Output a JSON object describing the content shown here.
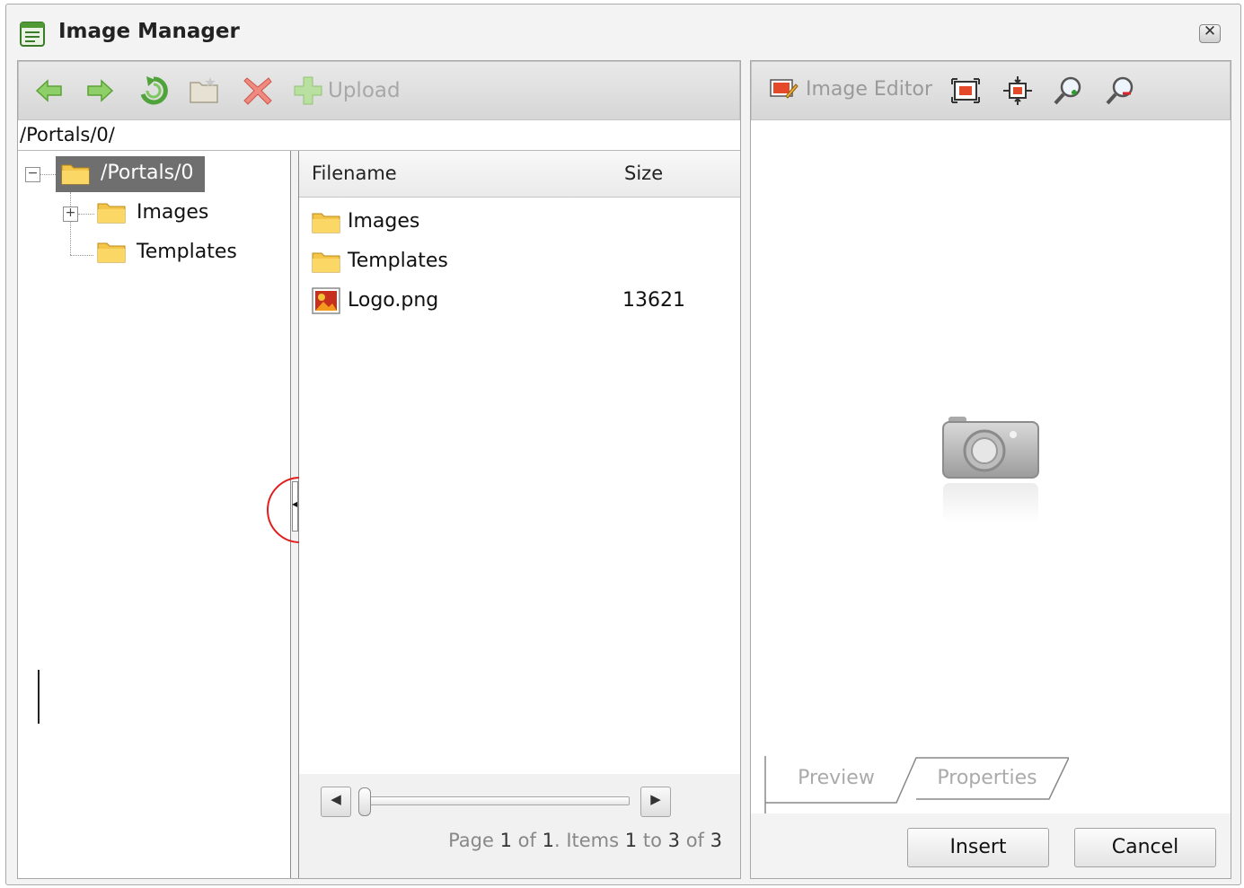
{
  "window": {
    "title": "Image Manager",
    "close_glyph": "✕"
  },
  "toolbar": {
    "icons": [
      "back-arrow-icon",
      "forward-arrow-icon",
      "refresh-icon",
      "new-folder-icon",
      "delete-icon"
    ],
    "upload_label": "Upload"
  },
  "path": "/Portals/0/",
  "tree": {
    "root_label": "/Portals/0",
    "items": [
      {
        "label": "Images"
      },
      {
        "label": "Templates"
      }
    ]
  },
  "grid": {
    "columns": {
      "filename": "Filename",
      "size": "Size"
    },
    "rows": [
      {
        "name": "Images",
        "size": "",
        "type": "folder"
      },
      {
        "name": "Templates",
        "size": "",
        "type": "folder"
      },
      {
        "name": "Logo.png",
        "size": "13621",
        "type": "image"
      }
    ],
    "pager": {
      "page_word": "Page",
      "page": "1",
      "of_word": "of",
      "pages": "1",
      "items_word": ". Items",
      "from": "1",
      "to_word": "to",
      "to": "3",
      "of_word2": "of",
      "total": "3"
    }
  },
  "editor": {
    "image_editor_label": "Image Editor",
    "tools": [
      "best-fit-icon",
      "actual-size-icon",
      "zoom-in-icon",
      "zoom-out-icon"
    ],
    "tabs": {
      "preview": "Preview",
      "properties": "Properties"
    },
    "insert_label": "Insert",
    "cancel_label": "Cancel"
  }
}
